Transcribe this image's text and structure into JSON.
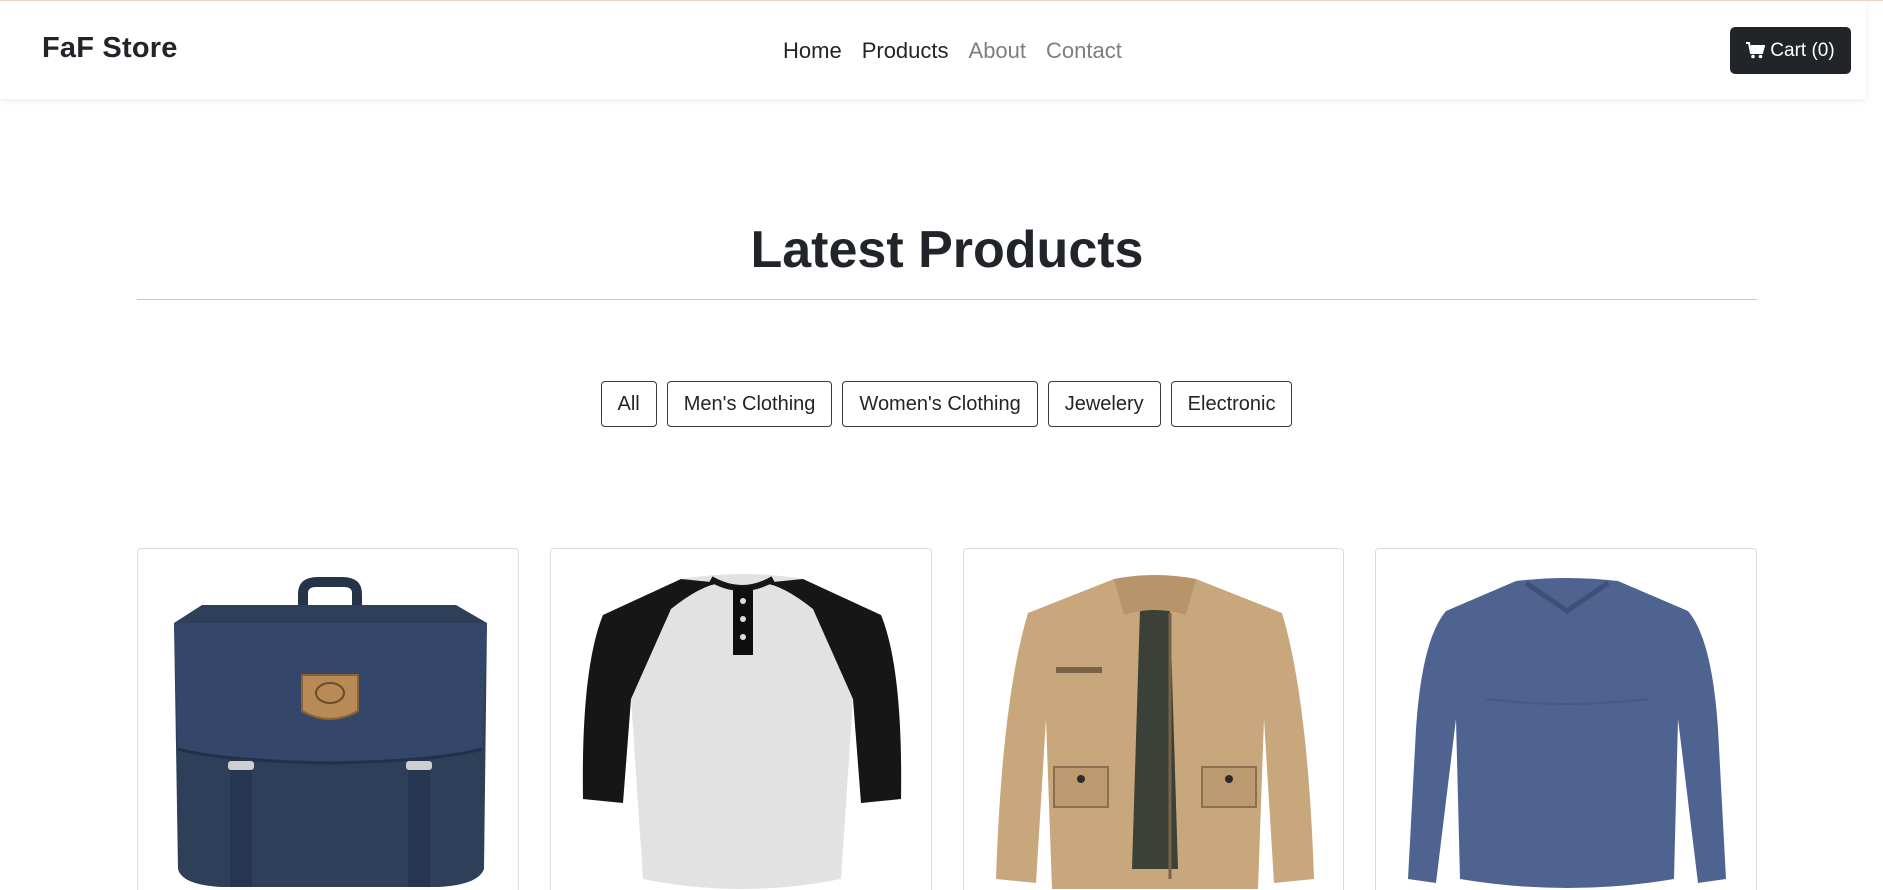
{
  "navbar": {
    "brand": "FaF Store",
    "links": [
      {
        "label": "Home"
      },
      {
        "label": "Products"
      },
      {
        "label": "About"
      },
      {
        "label": "Contact"
      }
    ],
    "cart_label": "Cart (0)",
    "cart_icon": "shopping-cart-icon"
  },
  "main": {
    "title": "Latest Products",
    "filters": [
      {
        "label": "All"
      },
      {
        "label": "Men's Clothing"
      },
      {
        "label": "Women's Clothing"
      },
      {
        "label": "Jewelery"
      },
      {
        "label": "Electronic"
      }
    ],
    "products": [
      {
        "image": "navy-backpack-image"
      },
      {
        "image": "raglan-henley-tshirt-image"
      },
      {
        "image": "khaki-jacket-image"
      },
      {
        "image": "blue-longsleeve-shirt-image"
      }
    ]
  },
  "colors": {
    "dark": "#212529",
    "muted_link": "#7a7f84",
    "divider": "#c8c8c8"
  }
}
